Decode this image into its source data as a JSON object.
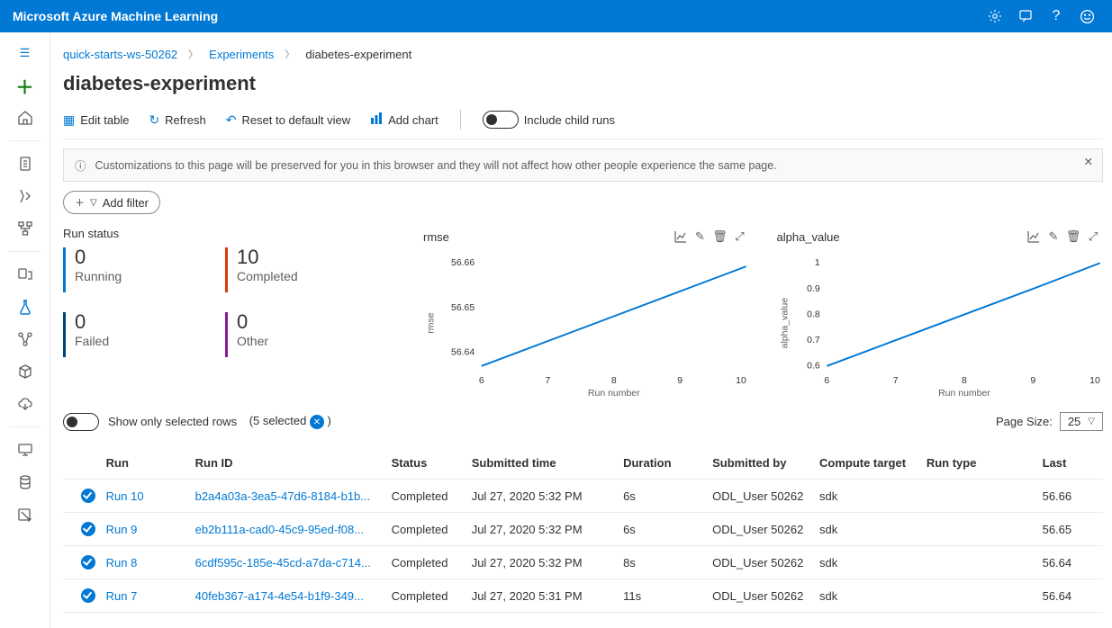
{
  "app_title": "Microsoft Azure Machine Learning",
  "breadcrumb": {
    "workspace": "quick-starts-ws-50262",
    "experiments": "Experiments",
    "current": "diabetes-experiment"
  },
  "page_title": "diabetes-experiment",
  "toolbar": {
    "edit": "Edit table",
    "refresh": "Refresh",
    "reset": "Reset to default view",
    "addchart": "Add chart",
    "childruns": "Include child runs"
  },
  "infobar": {
    "text": "Customizations to this page will be preserved for you in this browser and they will not affect how other people experience the same page."
  },
  "add_filter": "Add filter",
  "run_status_label": "Run status",
  "status_tiles": [
    {
      "value": "0",
      "label": "Running",
      "color": "#0078d4"
    },
    {
      "value": "10",
      "label": "Completed",
      "color": "#d83b01"
    },
    {
      "value": "0",
      "label": "Failed",
      "color": "#004578"
    },
    {
      "value": "0",
      "label": "Other",
      "color": "#881798"
    }
  ],
  "charts": [
    {
      "title": "rmse",
      "ylabel": "rmse",
      "xlabel": "Run number",
      "y_ticks": [
        "56.66",
        "56.65",
        "56.64"
      ],
      "x_ticks": [
        "6",
        "7",
        "8",
        "9",
        "10"
      ]
    },
    {
      "title": "alpha_value",
      "ylabel": "alpha_value",
      "xlabel": "Run number",
      "y_ticks": [
        "1",
        "0.9",
        "0.8",
        "0.7",
        "0.6"
      ],
      "x_ticks": [
        "6",
        "7",
        "8",
        "9",
        "10"
      ]
    }
  ],
  "chart_data": [
    {
      "type": "line",
      "title": "rmse",
      "xlabel": "Run number",
      "ylabel": "rmse",
      "x": [
        6,
        7,
        8,
        9,
        10
      ],
      "values": [
        56.635,
        56.642,
        56.648,
        56.655,
        56.662
      ],
      "ylim": [
        56.63,
        56.67
      ]
    },
    {
      "type": "line",
      "title": "alpha_value",
      "xlabel": "Run number",
      "ylabel": "alpha_value",
      "x": [
        6,
        7,
        8,
        9,
        10
      ],
      "values": [
        0.6,
        0.7,
        0.8,
        0.9,
        1.0
      ],
      "ylim": [
        0.6,
        1.0
      ]
    }
  ],
  "selected_rows": {
    "label": "Show only selected rows",
    "count_text": "(5 selected",
    "clear": "×"
  },
  "page_size": {
    "label": "Page Size:",
    "value": "25"
  },
  "table": {
    "cols": {
      "run": "Run",
      "id": "Run ID",
      "status": "Status",
      "time": "Submitted time",
      "dur": "Duration",
      "by": "Submitted by",
      "target": "Compute target",
      "type": "Run type",
      "last": "Last"
    },
    "rows": [
      {
        "run": "Run 10",
        "id": "b2a4a03a-3ea5-47d6-8184-b1b...",
        "status": "Completed",
        "time": "Jul 27, 2020 5:32 PM",
        "dur": "6s",
        "by": "ODL_User 50262",
        "target": "sdk",
        "type": "",
        "last": "56.66"
      },
      {
        "run": "Run 9",
        "id": "eb2b111a-cad0-45c9-95ed-f08...",
        "status": "Completed",
        "time": "Jul 27, 2020 5:32 PM",
        "dur": "6s",
        "by": "ODL_User 50262",
        "target": "sdk",
        "type": "",
        "last": "56.65"
      },
      {
        "run": "Run 8",
        "id": "6cdf595c-185e-45cd-a7da-c714...",
        "status": "Completed",
        "time": "Jul 27, 2020 5:32 PM",
        "dur": "8s",
        "by": "ODL_User 50262",
        "target": "sdk",
        "type": "",
        "last": "56.64"
      },
      {
        "run": "Run 7",
        "id": "40feb367-a174-4e54-b1f9-349...",
        "status": "Completed",
        "time": "Jul 27, 2020 5:31 PM",
        "dur": "11s",
        "by": "ODL_User 50262",
        "target": "sdk",
        "type": "",
        "last": "56.64"
      }
    ]
  }
}
